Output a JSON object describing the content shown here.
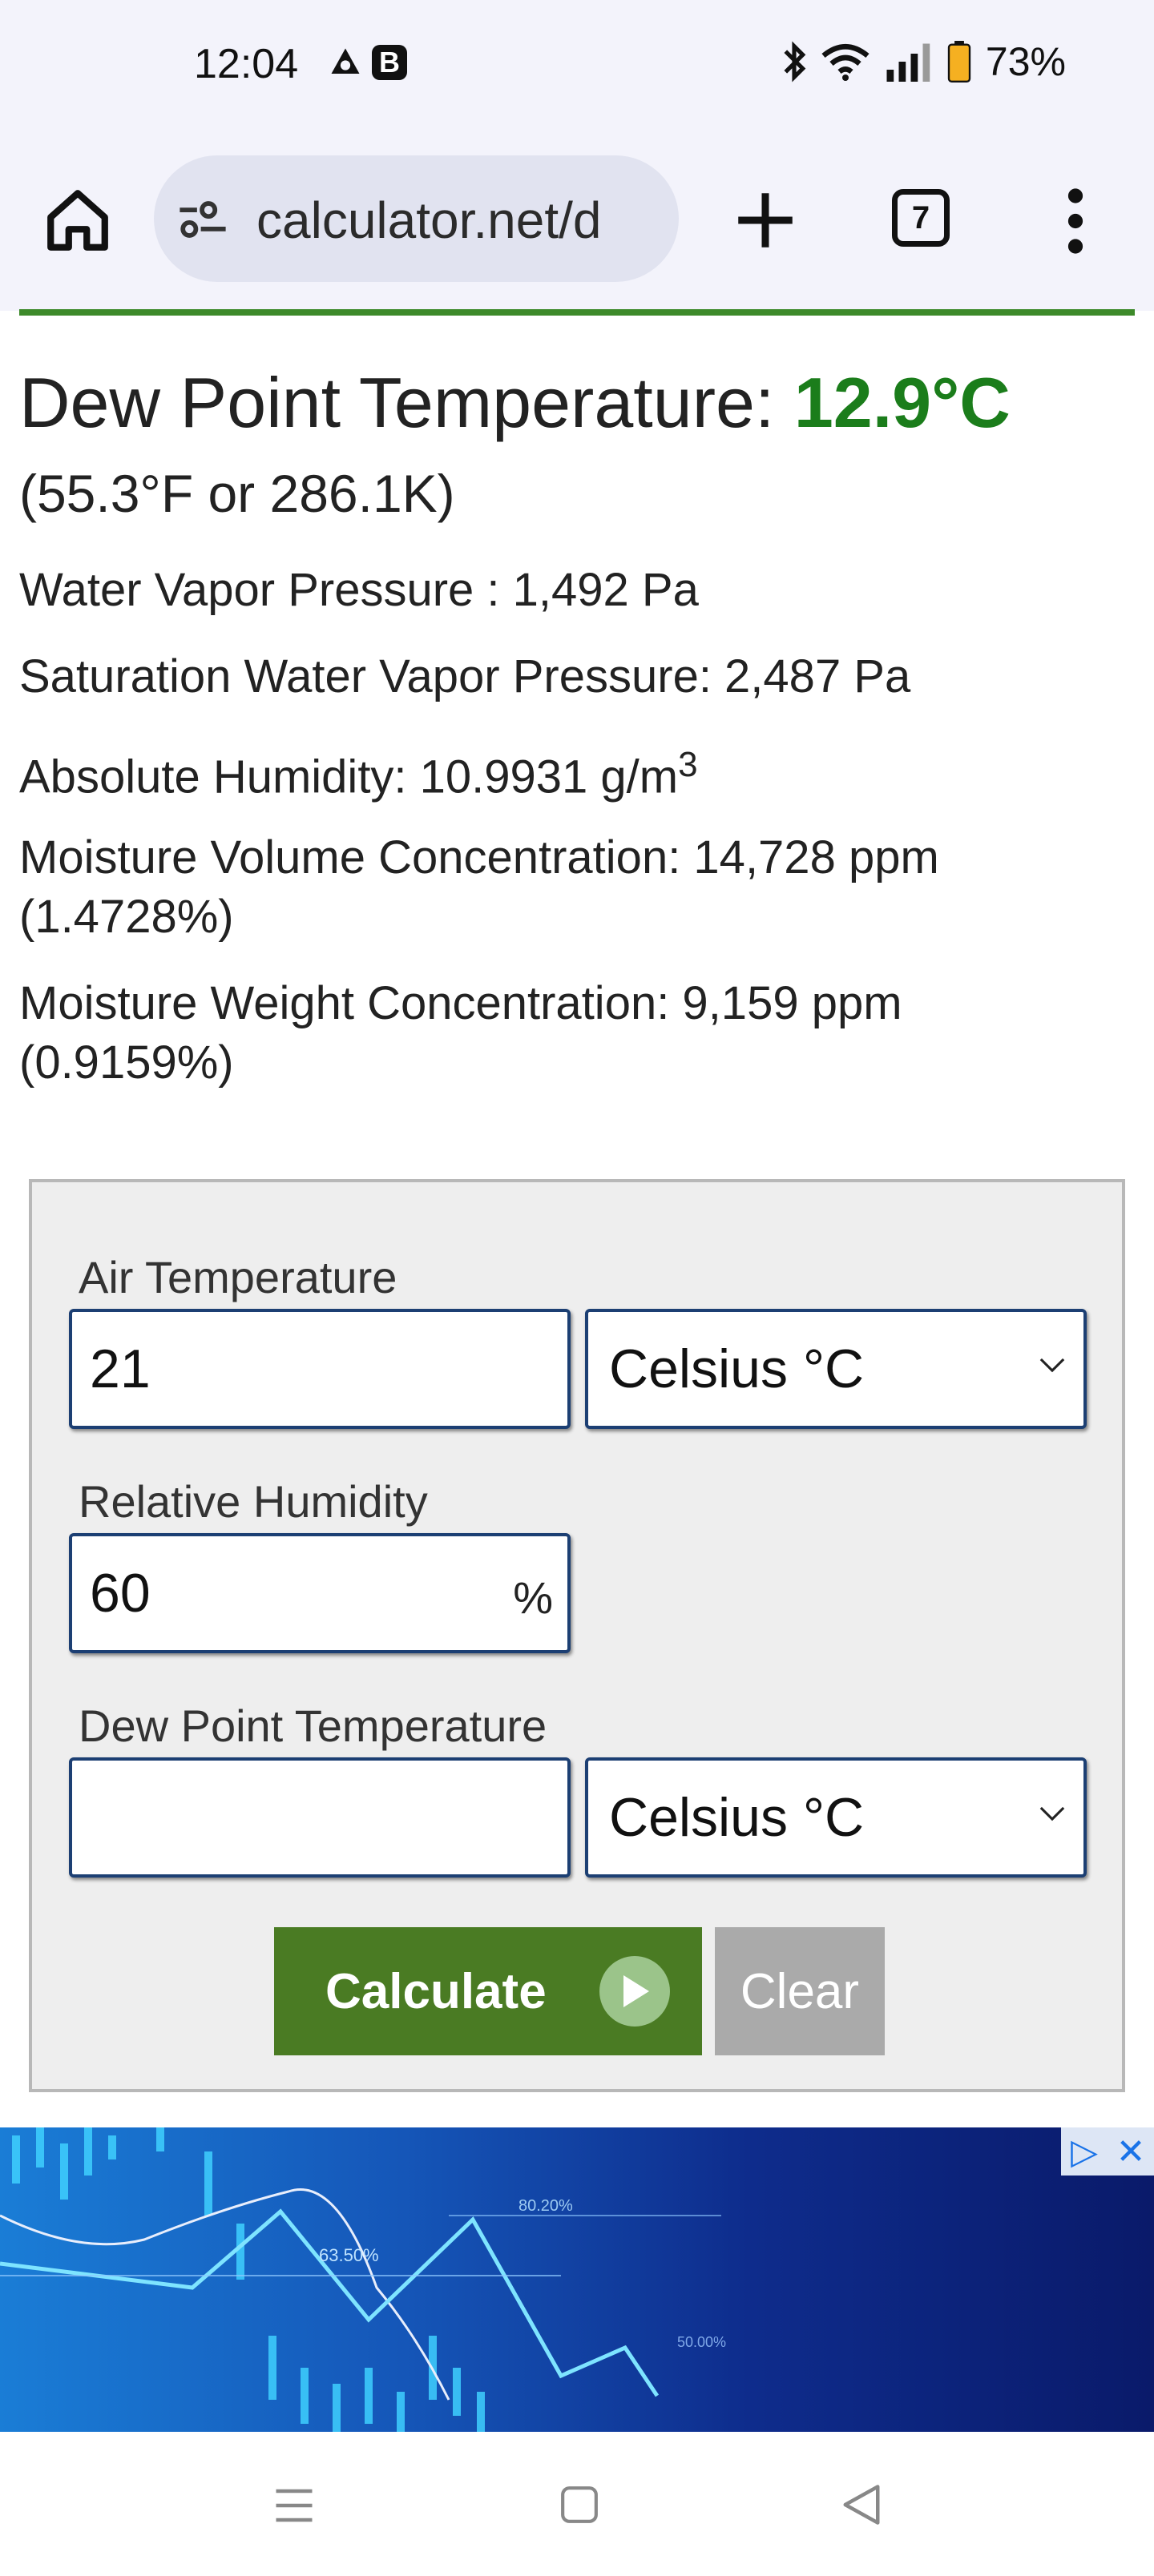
{
  "status_bar": {
    "time": "12:04",
    "b_badge": "B",
    "battery": "73%",
    "icons": [
      "drive-icon",
      "bluetooth-icon",
      "wifi-icon",
      "signal-icon",
      "battery-icon"
    ]
  },
  "browser": {
    "url": "calculator.net/d",
    "tab_count": "7"
  },
  "result": {
    "title_label": "Dew Point Temperature: ",
    "title_value": "12.9°C",
    "subtitle": "(55.3°F or 286.1K)",
    "water_vapor_pressure": "Water Vapor Pressure : 1,492 Pa",
    "saturation_pressure": "Saturation Water Vapor Pressure: 2,487 Pa",
    "absolute_humidity": "Absolute Humidity: 10.9931 g/m",
    "absolute_humidity_sup": "3",
    "moisture_volume": "Moisture Volume Concentration: 14,728 ppm",
    "moisture_volume_pct": "(1.4728%)",
    "moisture_weight": "Moisture Weight Concentration: 9,159 ppm",
    "moisture_weight_pct": "(0.9159%)"
  },
  "form": {
    "air_temp_label": "Air Temperature",
    "air_temp_value": "21",
    "air_temp_unit": "Celsius °C",
    "rh_label": "Relative Humidity",
    "rh_value": "60",
    "rh_unit": "%",
    "dew_label": "Dew Point Temperature",
    "dew_value": "",
    "dew_unit": "Celsius °C",
    "calculate_label": "Calculate",
    "clear_label": "Clear"
  },
  "ad": {
    "labels": [
      "63.50%",
      "80.20%",
      "50.00%"
    ]
  },
  "colors": {
    "accent_green": "#4a7b23",
    "result_green": "#1b7d1b",
    "input_border": "#1c3f73"
  }
}
